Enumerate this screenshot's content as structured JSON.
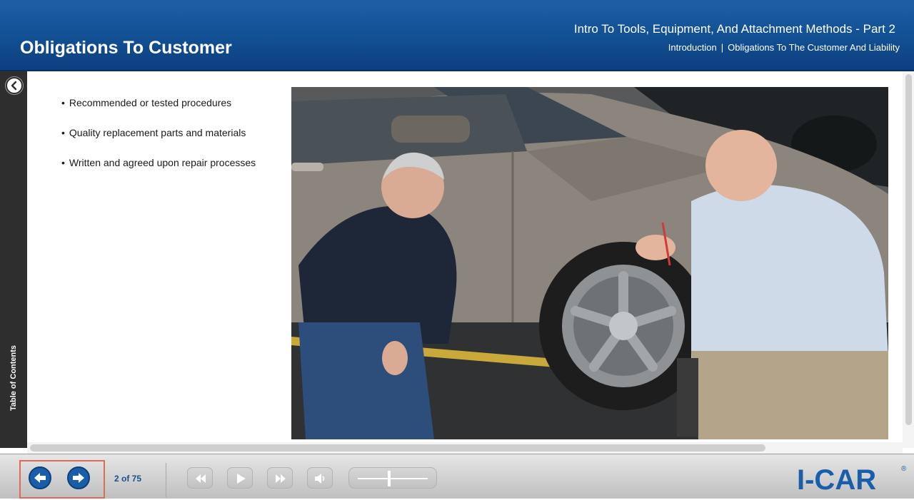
{
  "header": {
    "course_title": "Intro To Tools, Equipment, And Attachment Methods - Part 2",
    "breadcrumb": [
      "Introduction",
      "Obligations To The Customer And Liability"
    ],
    "breadcrumb_separator": "|",
    "page_title": "Obligations To Customer"
  },
  "sidebar": {
    "toc_label": "Table of Contents",
    "collapse_icon": "chevron-left-icon"
  },
  "content": {
    "bullets": [
      "Recommended or tested procedures",
      "Quality replacement parts and materials",
      "Written and agreed upon repair processes"
    ]
  },
  "footer": {
    "page_indicator": "2 of 75",
    "buttons": [
      "back-arrow-icon",
      "forward-arrow-icon",
      "rewind-icon",
      "play-icon",
      "fast-forward-icon",
      "volume-icon"
    ],
    "logo_text": "I-CAR",
    "logo_mark": "®"
  },
  "colors": {
    "header_blue": "#124f93",
    "nav_blue": "#1a5ea9",
    "highlight_box": "#e06a55",
    "rail_dark": "#2e2e2e"
  }
}
